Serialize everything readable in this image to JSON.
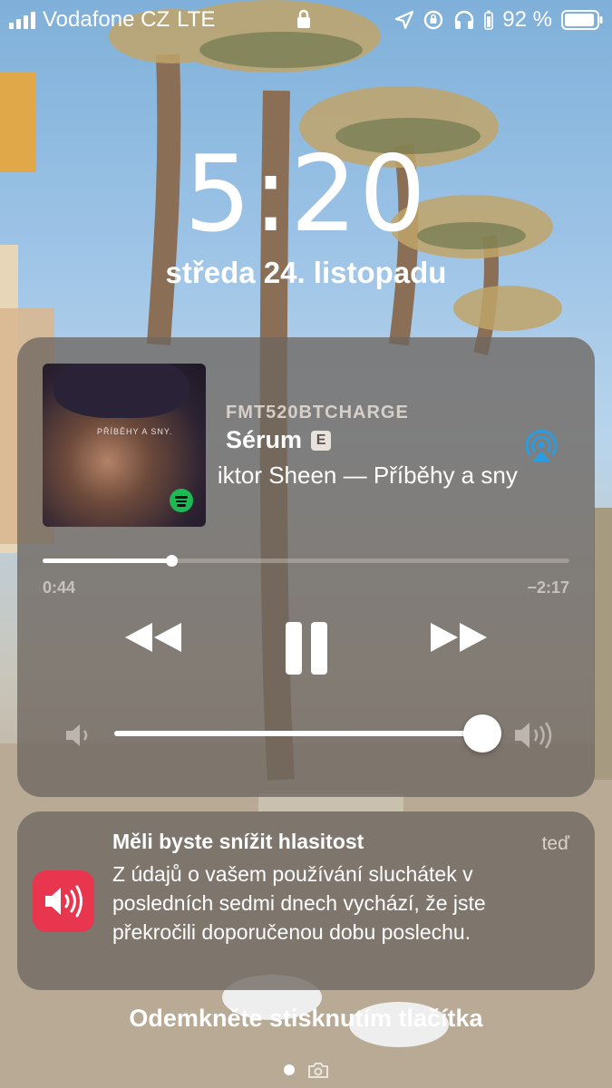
{
  "status_bar": {
    "carrier": "Vodafone CZ",
    "network": "LTE",
    "battery_percent": "92 %"
  },
  "lock_screen": {
    "time": "5:20",
    "date": "středa 24. listopadu"
  },
  "now_playing": {
    "device": "FMT520BTCHARGE",
    "track": "Sérum",
    "explicit_badge": "E",
    "artist_album": "Viktor Sheen — Příběhy a sny",
    "album_art_caption": "PŘÍBĚHY A SNY.",
    "elapsed": "0:44",
    "remaining": "−2:17",
    "progress_fraction": 0.245,
    "volume_fraction": 0.95
  },
  "notification": {
    "title": "Měli byste snížit hlasitost",
    "time": "teď",
    "body": "Z údajů o vašem používání sluchátek v posledních sedmi dnech vychází, že jste překročili doporučenou dobu poslechu.",
    "icon": "speaker-wave-icon",
    "icon_color": "#e8364f"
  },
  "unlock_hint": "Odemkněte stisknutím tlačítka"
}
